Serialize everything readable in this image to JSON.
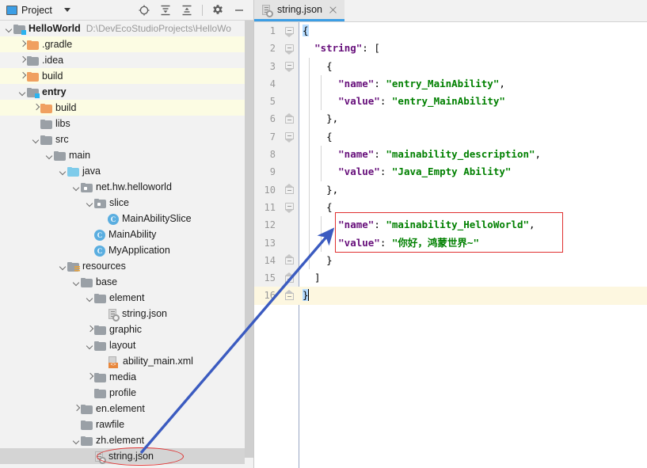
{
  "tool_window": {
    "title": "Project",
    "title_icon": "project-window-icon",
    "dropdown_icon": "chevron-down-icon",
    "actions": [
      {
        "name": "scroll-from-source-icon",
        "label": "Select Opened File"
      },
      {
        "name": "expand-all-icon",
        "label": "Expand All"
      },
      {
        "name": "collapse-all-icon",
        "label": "Collapse All"
      },
      {
        "name": "settings-gear-icon",
        "label": "Settings"
      },
      {
        "name": "hide-icon",
        "label": "Hide"
      }
    ]
  },
  "tree": {
    "rows": [
      {
        "label": "HelloWorld",
        "hint": "D:\\DevEcoStudioProjects\\HelloWo",
        "indent": 0,
        "arrow": "down",
        "icon": "module-folder-icon",
        "icon_class": "folder gray module",
        "bold": true,
        "bg": "plain"
      },
      {
        "label": ".gradle",
        "hint": "",
        "indent": 1,
        "arrow": "right",
        "icon": "folder-icon",
        "icon_class": "folder orange",
        "bold": false,
        "bg": "yellow"
      },
      {
        "label": ".idea",
        "hint": "",
        "indent": 1,
        "arrow": "right",
        "icon": "folder-icon",
        "icon_class": "folder gray",
        "bold": false,
        "bg": "gray"
      },
      {
        "label": "build",
        "hint": "",
        "indent": 1,
        "arrow": "right",
        "icon": "folder-icon",
        "icon_class": "folder orange",
        "bold": false,
        "bg": "yellow"
      },
      {
        "label": "entry",
        "hint": "",
        "indent": 1,
        "arrow": "down",
        "icon": "module-folder-icon",
        "icon_class": "folder gray module",
        "bold": true,
        "bg": "gray"
      },
      {
        "label": "build",
        "hint": "",
        "indent": 2,
        "arrow": "right",
        "icon": "folder-icon",
        "icon_class": "folder orange",
        "bold": false,
        "bg": "yellow"
      },
      {
        "label": "libs",
        "hint": "",
        "indent": 2,
        "arrow": "none",
        "icon": "folder-icon",
        "icon_class": "folder gray",
        "bold": false,
        "bg": "plain"
      },
      {
        "label": "src",
        "hint": "",
        "indent": 2,
        "arrow": "down",
        "icon": "folder-icon",
        "icon_class": "folder gray",
        "bold": false,
        "bg": "plain"
      },
      {
        "label": "main",
        "hint": "",
        "indent": 3,
        "arrow": "down",
        "icon": "folder-icon",
        "icon_class": "folder gray",
        "bold": false,
        "bg": "plain"
      },
      {
        "label": "java",
        "hint": "",
        "indent": 4,
        "arrow": "down",
        "icon": "source-folder-icon",
        "icon_class": "folder blue",
        "bold": false,
        "bg": "plain"
      },
      {
        "label": "net.hw.helloworld",
        "hint": "",
        "indent": 5,
        "arrow": "down",
        "icon": "package-icon",
        "icon_class": "folder pkg",
        "bold": false,
        "bg": "plain"
      },
      {
        "label": "slice",
        "hint": "",
        "indent": 6,
        "arrow": "down",
        "icon": "package-icon",
        "icon_class": "folder pkg",
        "bold": false,
        "bg": "plain"
      },
      {
        "label": "MainAbilitySlice",
        "hint": "",
        "indent": 7,
        "arrow": "none",
        "icon": "java-class-icon",
        "icon_class": "cls",
        "bold": false,
        "bg": "plain"
      },
      {
        "label": "MainAbility",
        "hint": "",
        "indent": 6,
        "arrow": "none",
        "icon": "java-class-icon",
        "icon_class": "cls",
        "bold": false,
        "bg": "plain"
      },
      {
        "label": "MyApplication",
        "hint": "",
        "indent": 6,
        "arrow": "none",
        "icon": "java-class-icon",
        "icon_class": "cls",
        "bold": false,
        "bg": "plain"
      },
      {
        "label": "resources",
        "hint": "",
        "indent": 4,
        "arrow": "down",
        "icon": "resources-folder-icon",
        "icon_class": "folder gray res",
        "bold": false,
        "bg": "plain"
      },
      {
        "label": "base",
        "hint": "",
        "indent": 5,
        "arrow": "down",
        "icon": "folder-icon",
        "icon_class": "folder gray",
        "bold": false,
        "bg": "plain"
      },
      {
        "label": "element",
        "hint": "",
        "indent": 6,
        "arrow": "down",
        "icon": "folder-icon",
        "icon_class": "folder gray",
        "bold": false,
        "bg": "plain"
      },
      {
        "label": "string.json",
        "hint": "",
        "indent": 7,
        "arrow": "none",
        "icon": "json-file-icon",
        "icon_class": "jsonfile",
        "bold": false,
        "bg": "plain"
      },
      {
        "label": "graphic",
        "hint": "",
        "indent": 6,
        "arrow": "right",
        "icon": "folder-icon",
        "icon_class": "folder gray",
        "bold": false,
        "bg": "plain"
      },
      {
        "label": "layout",
        "hint": "",
        "indent": 6,
        "arrow": "down",
        "icon": "folder-icon",
        "icon_class": "folder gray",
        "bold": false,
        "bg": "plain"
      },
      {
        "label": "ability_main.xml",
        "hint": "",
        "indent": 7,
        "arrow": "none",
        "icon": "xml-file-icon",
        "icon_class": "xmlfile",
        "bold": false,
        "bg": "plain"
      },
      {
        "label": "media",
        "hint": "",
        "indent": 6,
        "arrow": "right",
        "icon": "folder-icon",
        "icon_class": "folder gray",
        "bold": false,
        "bg": "plain"
      },
      {
        "label": "profile",
        "hint": "",
        "indent": 6,
        "arrow": "none",
        "icon": "folder-icon",
        "icon_class": "folder gray",
        "bold": false,
        "bg": "plain"
      },
      {
        "label": "en.element",
        "hint": "",
        "indent": 5,
        "arrow": "right",
        "icon": "folder-icon",
        "icon_class": "folder gray",
        "bold": false,
        "bg": "plain"
      },
      {
        "label": "rawfile",
        "hint": "",
        "indent": 5,
        "arrow": "none",
        "icon": "folder-icon",
        "icon_class": "folder gray",
        "bold": false,
        "bg": "plain"
      },
      {
        "label": "zh.element",
        "hint": "",
        "indent": 5,
        "arrow": "down",
        "icon": "folder-icon",
        "icon_class": "folder gray",
        "bold": false,
        "bg": "plain"
      },
      {
        "label": "string.json",
        "hint": "",
        "indent": 6,
        "arrow": "none",
        "icon": "json-file-icon",
        "icon_class": "jsonfile",
        "bold": false,
        "bg": "selected"
      }
    ]
  },
  "editor": {
    "tab": {
      "label": "string.json",
      "icon": "json-file-icon",
      "close_icon": "close-icon"
    },
    "lines": [
      {
        "n": "1",
        "fold": "top",
        "indent": 0,
        "current": false,
        "tokens": [
          {
            "t": "{",
            "c": "p hl"
          }
        ]
      },
      {
        "n": "2",
        "fold": "top",
        "indent": 0,
        "current": false,
        "tokens": [
          {
            "t": "  ",
            "c": "p"
          },
          {
            "t": "\"string\"",
            "c": "k"
          },
          {
            "t": ": [",
            "c": "p"
          }
        ]
      },
      {
        "n": "3",
        "fold": "top",
        "indent": 1,
        "current": false,
        "tokens": [
          {
            "t": "    {",
            "c": "p"
          }
        ]
      },
      {
        "n": "4",
        "fold": "",
        "indent": 2,
        "current": false,
        "tokens": [
          {
            "t": "      ",
            "c": "p"
          },
          {
            "t": "\"name\"",
            "c": "k"
          },
          {
            "t": ": ",
            "c": "p"
          },
          {
            "t": "\"entry_MainAbility\"",
            "c": "s"
          },
          {
            "t": ",",
            "c": "p"
          }
        ]
      },
      {
        "n": "5",
        "fold": "",
        "indent": 2,
        "current": false,
        "tokens": [
          {
            "t": "      ",
            "c": "p"
          },
          {
            "t": "\"value\"",
            "c": "k"
          },
          {
            "t": ": ",
            "c": "p"
          },
          {
            "t": "\"entry_MainAbility\"",
            "c": "s"
          }
        ]
      },
      {
        "n": "6",
        "fold": "bottom",
        "indent": 1,
        "current": false,
        "tokens": [
          {
            "t": "    },",
            "c": "p"
          }
        ]
      },
      {
        "n": "7",
        "fold": "top",
        "indent": 1,
        "current": false,
        "tokens": [
          {
            "t": "    {",
            "c": "p"
          }
        ]
      },
      {
        "n": "8",
        "fold": "",
        "indent": 2,
        "current": false,
        "tokens": [
          {
            "t": "      ",
            "c": "p"
          },
          {
            "t": "\"name\"",
            "c": "k"
          },
          {
            "t": ": ",
            "c": "p"
          },
          {
            "t": "\"mainability_description\"",
            "c": "s"
          },
          {
            "t": ",",
            "c": "p"
          }
        ]
      },
      {
        "n": "9",
        "fold": "",
        "indent": 2,
        "current": false,
        "tokens": [
          {
            "t": "      ",
            "c": "p"
          },
          {
            "t": "\"value\"",
            "c": "k"
          },
          {
            "t": ": ",
            "c": "p"
          },
          {
            "t": "\"Java_Empty Ability\"",
            "c": "s"
          }
        ]
      },
      {
        "n": "10",
        "fold": "bottom",
        "indent": 1,
        "current": false,
        "tokens": [
          {
            "t": "    },",
            "c": "p"
          }
        ]
      },
      {
        "n": "11",
        "fold": "top",
        "indent": 1,
        "current": false,
        "tokens": [
          {
            "t": "    {",
            "c": "p"
          }
        ]
      },
      {
        "n": "12",
        "fold": "",
        "indent": 2,
        "current": false,
        "tokens": [
          {
            "t": "      ",
            "c": "p"
          },
          {
            "t": "\"name\"",
            "c": "k"
          },
          {
            "t": ": ",
            "c": "p"
          },
          {
            "t": "\"mainability_HelloWorld\"",
            "c": "s"
          },
          {
            "t": ",",
            "c": "p"
          }
        ]
      },
      {
        "n": "13",
        "fold": "",
        "indent": 2,
        "current": false,
        "tokens": [
          {
            "t": "      ",
            "c": "p"
          },
          {
            "t": "\"value\"",
            "c": "k"
          },
          {
            "t": ": ",
            "c": "p"
          },
          {
            "t": "\"你好，鸿蒙世界~\"",
            "c": "s"
          }
        ]
      },
      {
        "n": "14",
        "fold": "bottom",
        "indent": 1,
        "current": false,
        "tokens": [
          {
            "t": "    }",
            "c": "p"
          }
        ]
      },
      {
        "n": "15",
        "fold": "bottom",
        "indent": 0,
        "current": false,
        "tokens": [
          {
            "t": "  ]",
            "c": "p"
          }
        ]
      },
      {
        "n": "16",
        "fold": "bottom",
        "indent": 0,
        "current": true,
        "tokens": [
          {
            "t": "}",
            "c": "p hl"
          }
        ],
        "caret": true
      }
    ]
  },
  "annotations": {
    "red_rect": {
      "name": "red-highlight-rectangle",
      "color": "#e03030"
    },
    "red_ellipse": {
      "name": "red-highlight-ellipse",
      "color": "#e03030"
    },
    "blue_arrow": {
      "name": "blue-pointer-arrow",
      "color": "#3b5bc0"
    }
  }
}
